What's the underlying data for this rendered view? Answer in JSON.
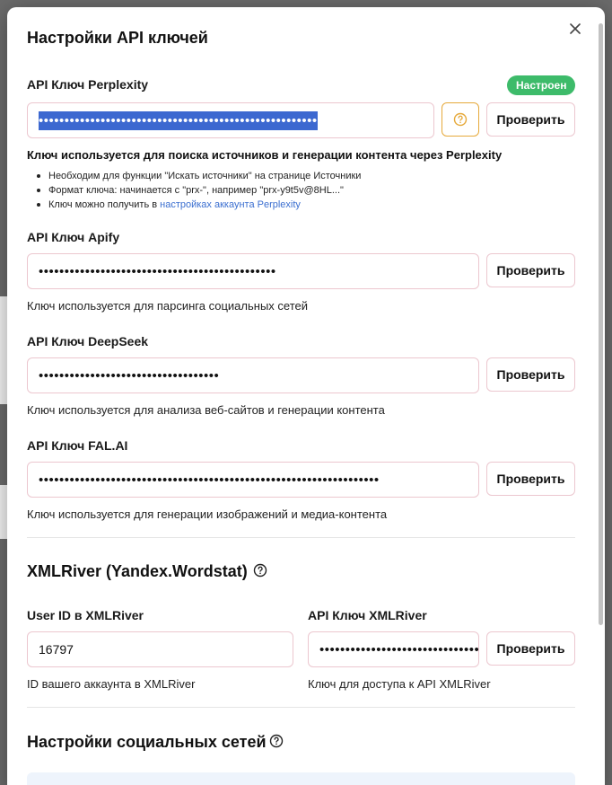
{
  "dialog": {
    "title": "Настройки API ключей"
  },
  "perplexity": {
    "label": "API Ключ Perplexity",
    "status_badge": "Настроен",
    "value_masked": "••••••••••••••••••••••••••••••••••••••••••••••••••••••",
    "check_label": "Проверить",
    "desc_bold": "Ключ используется для поиска источников и генерации контента через Perplexity",
    "bullets": [
      "Необходим для функции \"Искать источники\" на странице Источники",
      "Формат ключа: начинается с \"prx-\", например \"prx-y9t5v@8HL...\""
    ],
    "bullet3_prefix": "Ключ можно получить в ",
    "bullet3_link": "настройках аккаунта Perplexity"
  },
  "apify": {
    "label": "API Ключ Apify",
    "value_masked": "••••••••••••••••••••••••••••••••••••••••••••••",
    "check_label": "Проверить",
    "desc": "Ключ используется для парсинга социальных сетей"
  },
  "deepseek": {
    "label": "API Ключ DeepSeek",
    "value_masked": "•••••••••••••••••••••••••••••••••••",
    "check_label": "Проверить",
    "desc": "Ключ используется для анализа веб-сайтов и генерации контента"
  },
  "falai": {
    "label": "API Ключ FAL.AI",
    "value_masked": "••••••••••••••••••••••••••••••••••••••••••••••••••••••••••••••••••",
    "check_label": "Проверить",
    "desc": "Ключ используется для генерации изображений и медиа-контента"
  },
  "xmlriver": {
    "section_title": "XMLRiver (Yandex.Wordstat)",
    "user_id_label": "User ID в XMLRiver",
    "user_id_value": "16797",
    "user_id_desc": "ID вашего аккаунта в XMLRiver",
    "api_key_label": "API Ключ XMLRiver",
    "api_key_masked": "••••••••••••••••••••••••••••••••",
    "check_label": "Проверить",
    "api_key_desc": "Ключ для доступа к API XMLRiver"
  },
  "social": {
    "section_title": "Настройки социальных сетей"
  },
  "colors": {
    "badge_green": "#3dbb6a",
    "selection_blue": "#3c68d0",
    "help_border_orange": "#e6a93a",
    "input_border": "#ecc7cf",
    "link_blue": "#3b6fd0"
  }
}
